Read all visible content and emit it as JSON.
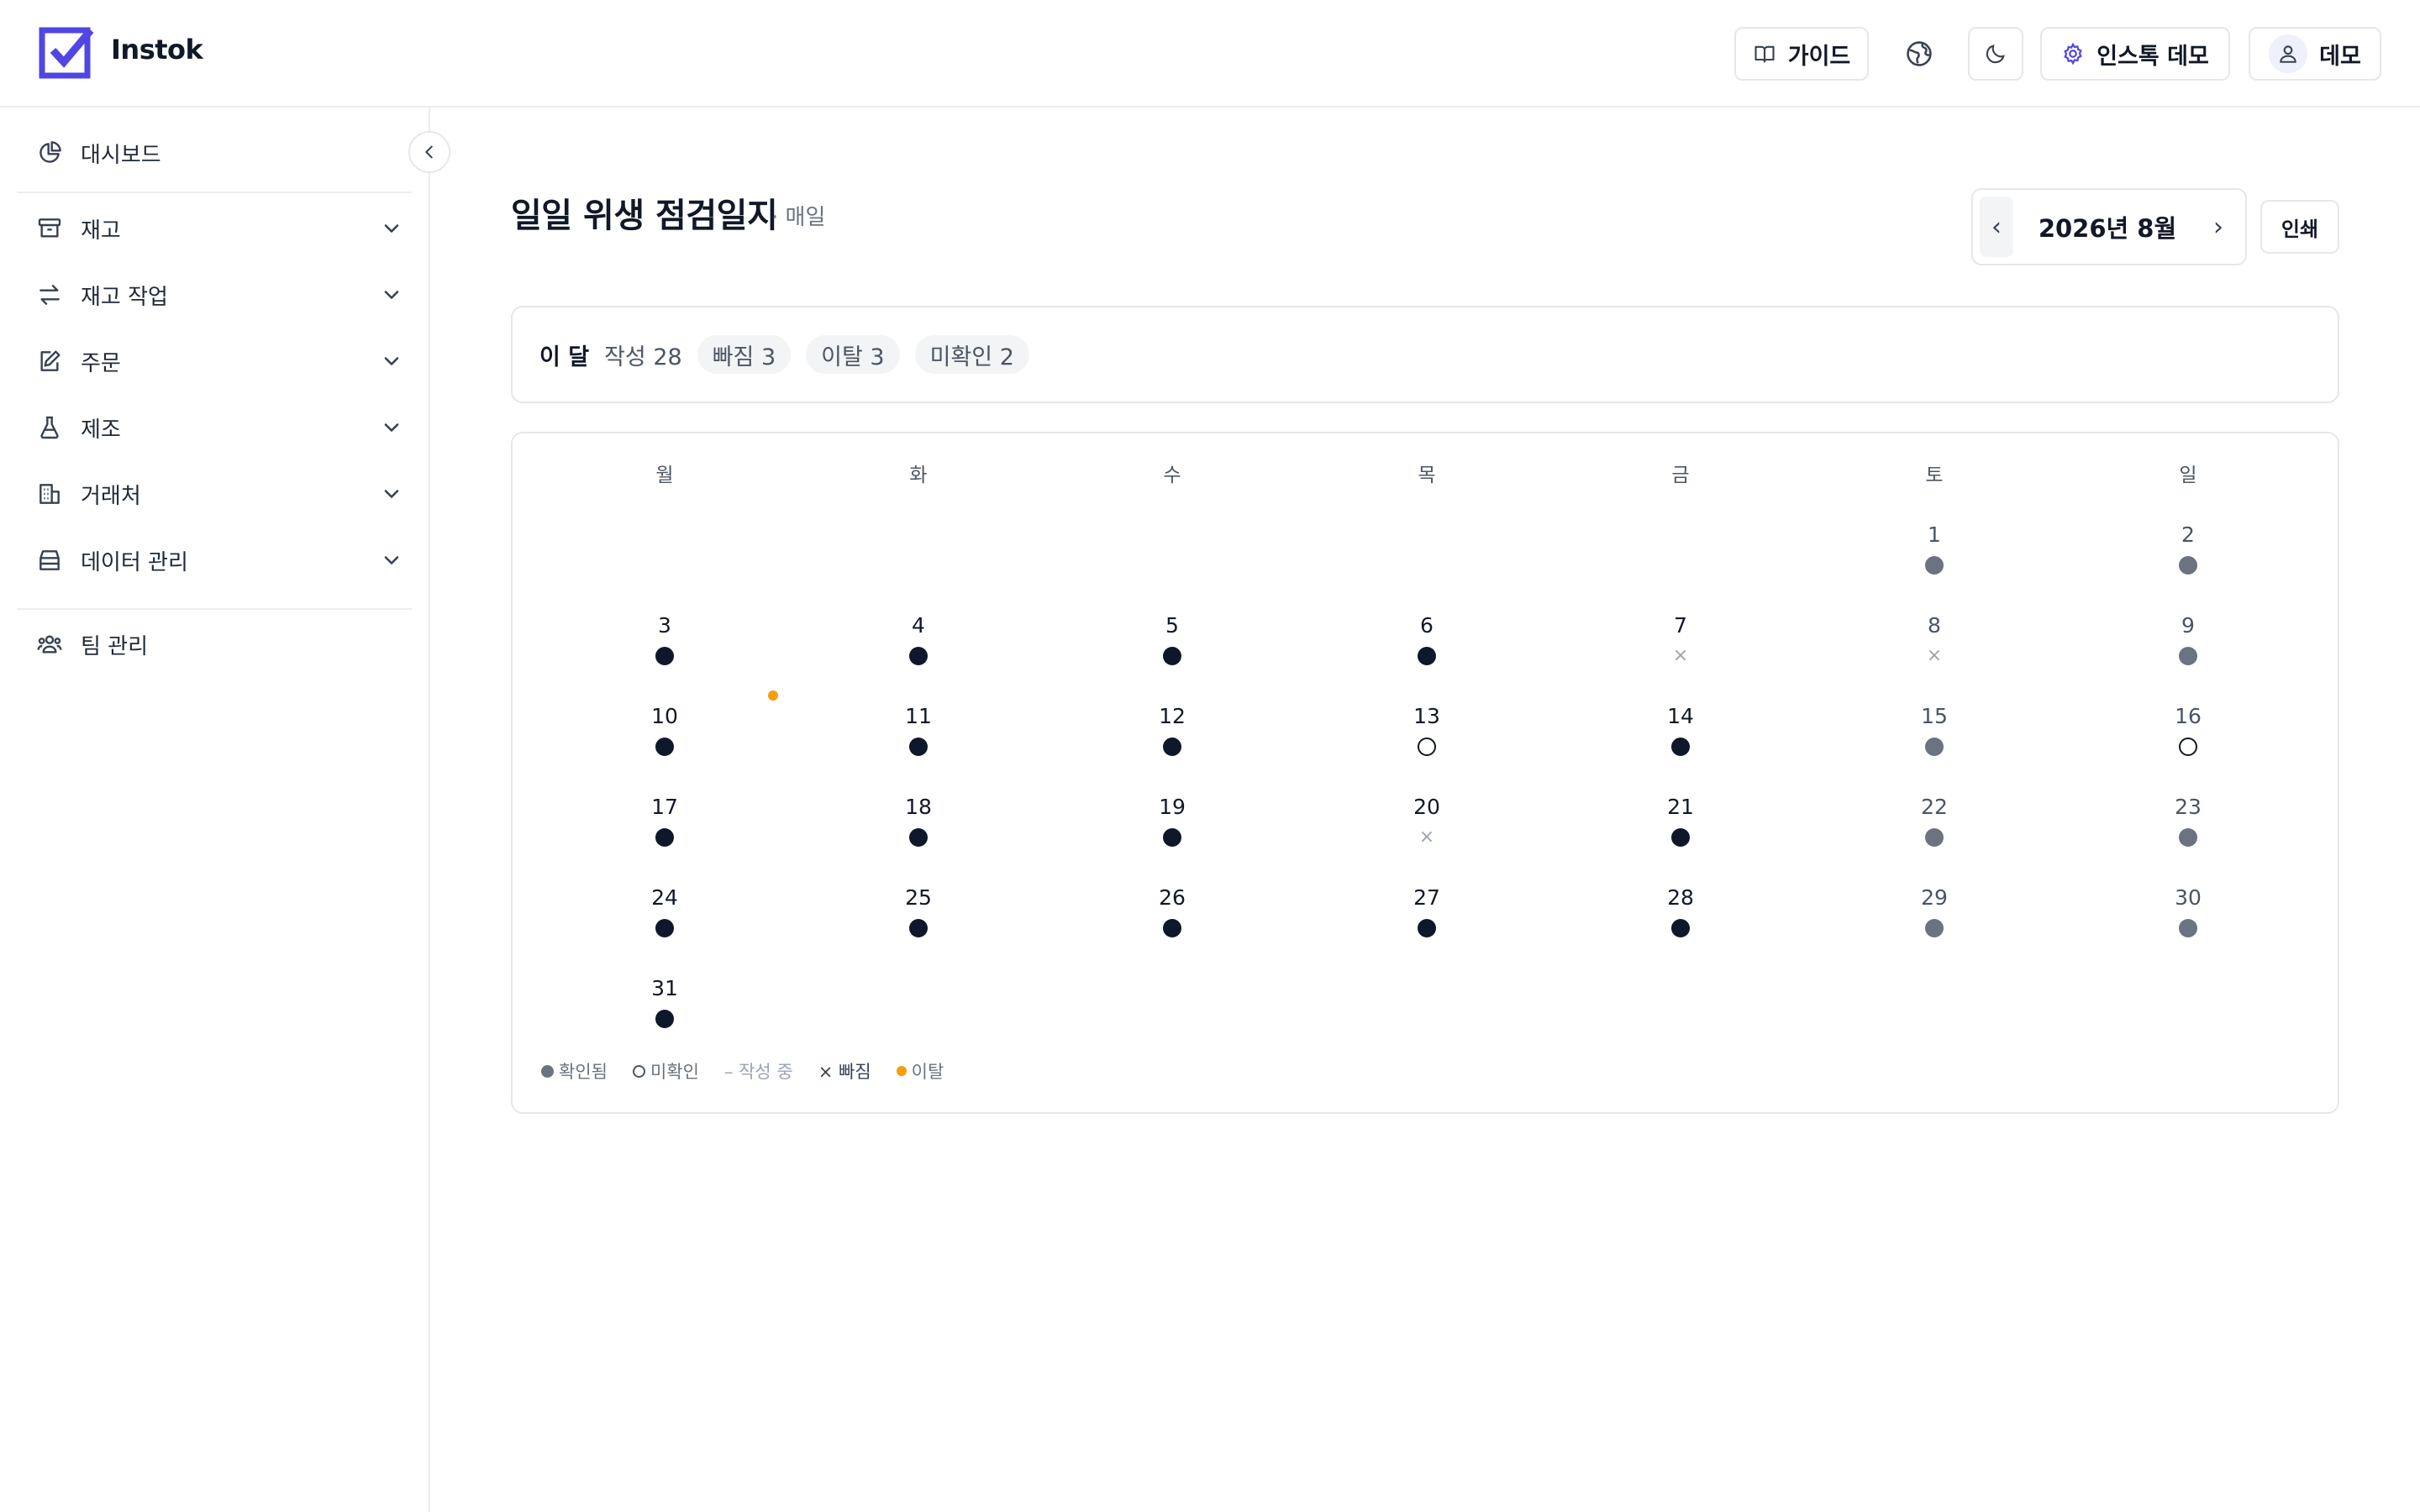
{
  "app": {
    "name": "Instok"
  },
  "header": {
    "guide_label": "가이드",
    "demo_settings_label": "인스톡 데모",
    "user_label": "데모"
  },
  "sidebar": {
    "items": [
      {
        "label": "대시보드",
        "icon": "pie-chart-icon",
        "expandable": false
      },
      {
        "label": "재고",
        "icon": "archive-box-icon",
        "expandable": true
      },
      {
        "label": "재고 작업",
        "icon": "arrows-swap-icon",
        "expandable": true
      },
      {
        "label": "주문",
        "icon": "edit-note-icon",
        "expandable": true
      },
      {
        "label": "제조",
        "icon": "flask-icon",
        "expandable": true
      },
      {
        "label": "거래처",
        "icon": "building-icon",
        "expandable": true
      },
      {
        "label": "데이터 관리",
        "icon": "database-icon",
        "expandable": true
      },
      {
        "label": "팀 관리",
        "icon": "team-icon",
        "expandable": false
      }
    ]
  },
  "page": {
    "title": "일일 위생 점검일지",
    "subtitle": "· 매일",
    "month_label": "2026년 8월",
    "prev_label": "‹",
    "next_label": "›",
    "print_label": "인쇄"
  },
  "summary": {
    "title": "이 달",
    "written": "작성 28",
    "missed": "빠짐 3",
    "deviation": "이탈 3",
    "unconfirmed": "미확인 2"
  },
  "calendar": {
    "weekdays": [
      "월",
      "화",
      "수",
      "목",
      "금",
      "토",
      "일"
    ],
    "weeks": [
      [
        null,
        null,
        null,
        null,
        null,
        {
          "d": "1",
          "s": "confirmed",
          "we": true
        },
        {
          "d": "2",
          "s": "confirmed",
          "we": true
        }
      ],
      [
        {
          "d": "3",
          "s": "confirmed"
        },
        {
          "d": "4",
          "s": "confirmed"
        },
        {
          "d": "5",
          "s": "confirmed"
        },
        {
          "d": "6",
          "s": "confirmed"
        },
        {
          "d": "7",
          "s": "missed"
        },
        {
          "d": "8",
          "s": "missed",
          "we": true
        },
        {
          "d": "9",
          "s": "confirmed",
          "we": true
        }
      ],
      [
        {
          "d": "10",
          "s": "confirmed"
        },
        {
          "d": "11",
          "s": "confirmed"
        },
        {
          "d": "12",
          "s": "confirmed"
        },
        {
          "d": "13",
          "s": "unconfirmed"
        },
        {
          "d": "14",
          "s": "confirmed"
        },
        {
          "d": "15",
          "s": "confirmed",
          "we": true
        },
        {
          "d": "16",
          "s": "unconfirmed",
          "we": true
        }
      ],
      [
        {
          "d": "17",
          "s": "confirmed"
        },
        {
          "d": "18",
          "s": "confirmed"
        },
        {
          "d": "19",
          "s": "confirmed"
        },
        {
          "d": "20",
          "s": "missed"
        },
        {
          "d": "21",
          "s": "confirmed"
        },
        {
          "d": "22",
          "s": "confirmed",
          "we": true
        },
        {
          "d": "23",
          "s": "confirmed",
          "we": true
        }
      ],
      [
        {
          "d": "24",
          "s": "confirmed"
        },
        {
          "d": "25",
          "s": "confirmed"
        },
        {
          "d": "26",
          "s": "confirmed"
        },
        {
          "d": "27",
          "s": "confirmed"
        },
        {
          "d": "28",
          "s": "confirmed"
        },
        {
          "d": "29",
          "s": "confirmed",
          "we": true
        },
        {
          "d": "30",
          "s": "confirmed",
          "we": true
        }
      ],
      [
        {
          "d": "31",
          "s": "confirmed"
        },
        null,
        null,
        null,
        null,
        null,
        null
      ]
    ]
  },
  "legend": {
    "confirmed": "확인됨",
    "unconfirmed": "미확인",
    "in_progress": "– 작성 중",
    "missed": "× 빠짐",
    "deviation": "이탈"
  },
  "colors": {
    "brand": "#4f46e5",
    "confirmed_weekday": "#0f172a",
    "confirmed_weekend": "#6b7280",
    "deviation": "#f59e0b"
  }
}
